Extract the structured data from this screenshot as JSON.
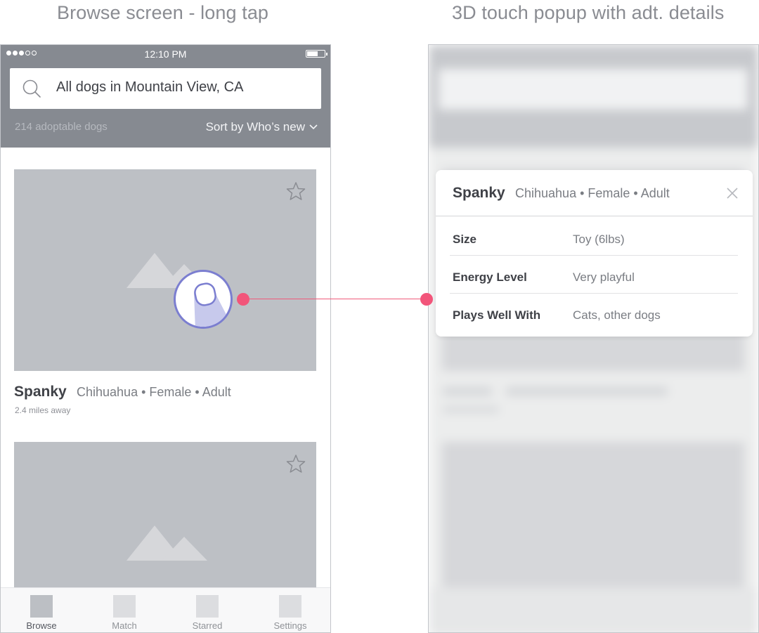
{
  "captions": {
    "left": "Browse screen - long tap",
    "right": "3D touch popup with adt. details"
  },
  "statusbar": {
    "time": "12:10 PM"
  },
  "search": {
    "text": "All dogs in Mountain View, CA"
  },
  "results": {
    "count": "214 adoptable dogs",
    "sort_label": "Sort by Who’s new"
  },
  "cards": [
    {
      "name": "Spanky",
      "description": "Chihuahua • Female • Adult",
      "distance": "2.4 miles away"
    }
  ],
  "tabs": [
    {
      "label": "Browse",
      "icon": "browse-icon"
    },
    {
      "label": "Match",
      "icon": "match-icon"
    },
    {
      "label": "Starred",
      "icon": "starred-icon"
    },
    {
      "label": "Settings",
      "icon": "settings-icon"
    }
  ],
  "popup": {
    "name": "Spanky",
    "description": "Chihuahua • Female • Adult",
    "details": [
      {
        "label": "Size",
        "value": "Toy (6lbs)"
      },
      {
        "label": "Energy Level",
        "value": "Very playful"
      },
      {
        "label": "Plays Well With",
        "value": "Cats, other dogs"
      }
    ]
  },
  "colors": {
    "header": "#868a91",
    "image_placeholder": "#bdc0c5",
    "accent_pink": "#f2557a",
    "touch_outline": "#7b7ed0"
  }
}
